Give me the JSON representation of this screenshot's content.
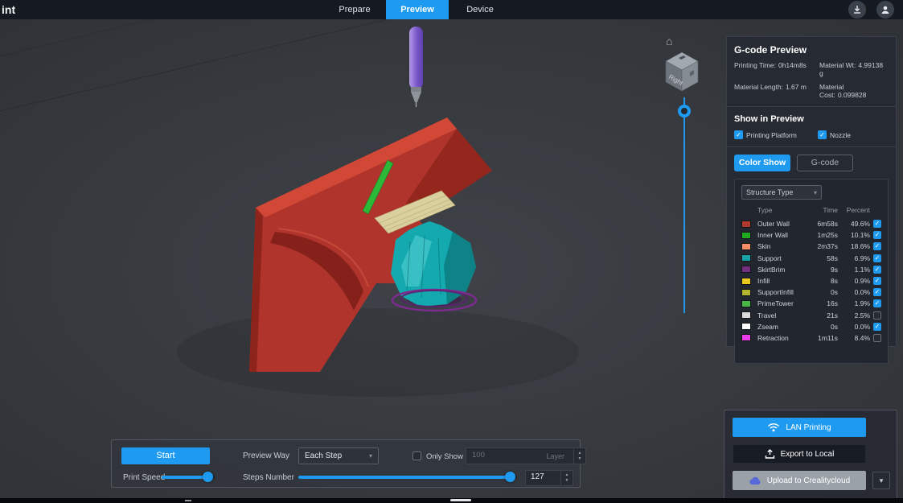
{
  "app": {
    "logo": "int",
    "tabs": [
      {
        "label": "Prepare",
        "active": false
      },
      {
        "label": "Preview",
        "active": true
      },
      {
        "label": "Device",
        "active": false
      }
    ]
  },
  "icons": {
    "check": "✓",
    "caret_down": "▾",
    "stepper_up": "▲",
    "stepper_down": "▼",
    "home": "⌂",
    "chevron_down": "▾"
  },
  "viewport": {
    "viewcube_label": "Right"
  },
  "gcode_panel": {
    "title": "G-code Preview",
    "stats": [
      {
        "label": "Printing Time:",
        "value": "0h14m8s"
      },
      {
        "label": "Material Wt:",
        "value": "4.99138 g"
      },
      {
        "label": "Material Length:",
        "value": "1.67 m"
      },
      {
        "label": "Material Cost:",
        "value": "0.099828"
      }
    ],
    "show_in_preview": {
      "title": "Show in Preview",
      "options": [
        {
          "label": "Printing Platform",
          "checked": true
        },
        {
          "label": "Nozzle",
          "checked": true
        }
      ]
    },
    "modes": [
      {
        "label": "Color Show",
        "active": true
      },
      {
        "label": "G-code",
        "active": false
      }
    ],
    "structure_dropdown_value": "Structure Type",
    "table": {
      "headers": {
        "type": "Type",
        "time": "Time",
        "percent": "Percent"
      },
      "rows": [
        {
          "color": "#b03a2e",
          "type": "Outer Wall",
          "time": "6m58s",
          "percent": "49.6%",
          "checked": true
        },
        {
          "color": "#1faa1f",
          "type": "Inner Wall",
          "time": "1m25s",
          "percent": "10.1%",
          "checked": true
        },
        {
          "color": "#f58d68",
          "type": "Skin",
          "time": "2m37s",
          "percent": "18.6%",
          "checked": true
        },
        {
          "color": "#17a2a8",
          "type": "Support",
          "time": "58s",
          "percent": "6.9%",
          "checked": true
        },
        {
          "color": "#73307f",
          "type": "SkirtBrim",
          "time": "9s",
          "percent": "1.1%",
          "checked": true
        },
        {
          "color": "#ecc81e",
          "type": "Infill",
          "time": "8s",
          "percent": "0.9%",
          "checked": true
        },
        {
          "color": "#b2b42f",
          "type": "SupportInfill",
          "time": "0s",
          "percent": "0.0%",
          "checked": true
        },
        {
          "color": "#49b649",
          "type": "PrimeTower",
          "time": "16s",
          "percent": "1.9%",
          "checked": true
        },
        {
          "color": "#d9d9d9",
          "type": "Travel",
          "time": "21s",
          "percent": "2.5%",
          "checked": false
        },
        {
          "color": "#ffffff",
          "type": "Zseam",
          "time": "0s",
          "percent": "0.0%",
          "checked": true
        },
        {
          "color": "#ea3dea",
          "type": "Retraction",
          "time": "1m11s",
          "percent": "8.4%",
          "checked": false
        }
      ]
    }
  },
  "playback": {
    "start_label": "Start",
    "print_speed_label": "Print Speed",
    "print_speed_percent": 88,
    "preview_way_label": "Preview Way",
    "preview_way_value": "Each Step",
    "only_show_label": "Only Show",
    "only_show_checked": false,
    "only_show_value": "100",
    "layer_unit_label": "Layer",
    "steps_number_label": "Steps Number",
    "steps_number_value": "127",
    "steps_slider_percent": 97
  },
  "output_panel": {
    "buttons": [
      {
        "label": "LAN Printing"
      },
      {
        "label": "Export to Local"
      },
      {
        "label": "Upload to Crealitycloud"
      }
    ]
  },
  "colors": {
    "accent": "#1e9bf0"
  }
}
